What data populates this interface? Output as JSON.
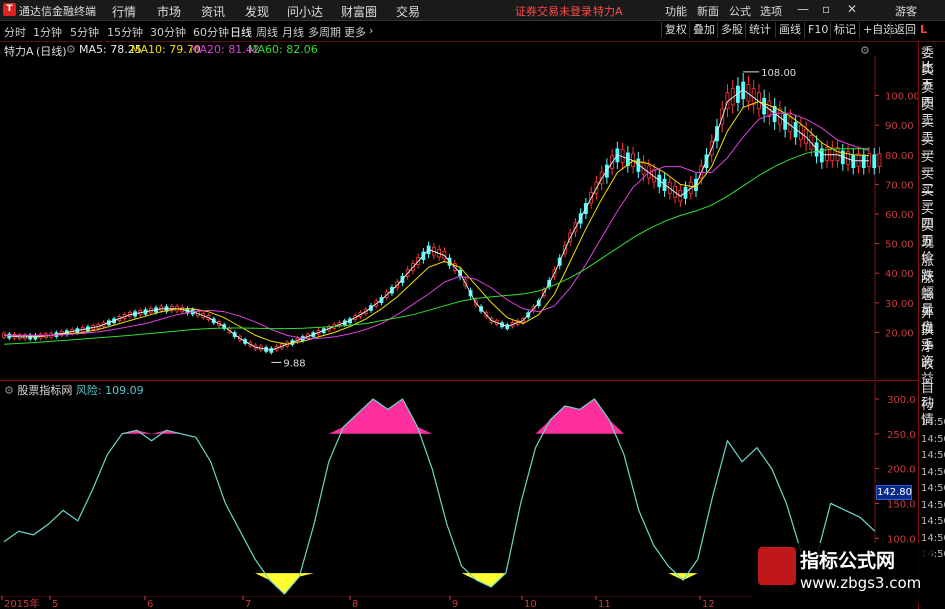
{
  "titlebar": {
    "app_title": "通达信金融终端",
    "menus": [
      "行情",
      "市场",
      "资讯",
      "发现",
      "问小达",
      "财富圈",
      "交易"
    ],
    "notice": "证券交易未登录",
    "stock_name": "特力A",
    "right_menus": [
      "功能",
      "新面",
      "公式",
      "选项"
    ],
    "guest": "游客"
  },
  "toolbar": {
    "periods": [
      "分时",
      "1分钟",
      "5分钟",
      "15分钟",
      "30分钟",
      "60分钟",
      "日线",
      "周线",
      "月线",
      "多周期",
      "更多"
    ],
    "active_period": "日线",
    "buttons": [
      "复权",
      "叠加",
      "多股",
      "统计",
      "画线",
      "F10",
      "标记",
      "+自选",
      "返回"
    ]
  },
  "infobar": {
    "stock_label": "特力A",
    "period_label": "(日线)",
    "ma5": "MA5: 78.25",
    "ma10": "MA10: 79.70",
    "ma20": "MA20: 81.42",
    "ma60": "MA60: 82.06",
    "colors": {
      "ma5": "#e8e8e8",
      "ma10": "#f0e000",
      "ma20": "#e040e0",
      "ma60": "#30e030"
    }
  },
  "indicator": {
    "label": "股票指标网",
    "risk_label": "风险:",
    "risk_value": "109.09",
    "current_badge": "142.80"
  },
  "main_chart_annotations": {
    "high_label": "108.00",
    "low_label": "9.88"
  },
  "sidebar": {
    "items": [
      "委比",
      "卖五",
      "卖四",
      "卖三",
      "卖二",
      "卖一",
      "买一",
      "买二",
      "买三",
      "买四",
      "买五",
      "现价",
      "涨跌",
      "涨幅",
      "总量",
      "外盘",
      "换手",
      "净资",
      "收益",
      "自动",
      "行情",
      "14:50",
      "14:50",
      "14:50",
      "14:50",
      "14:50",
      "14:50",
      "14:50",
      "14:50",
      "14:50"
    ]
  },
  "chart_data": [
    {
      "type": "candlestick",
      "title": "特力A (日线)",
      "y_ticks": [
        "100.00",
        "90.00",
        "80.00",
        "70.00",
        "60.00",
        "50.00",
        "40.00",
        "30.00",
        "20.00"
      ],
      "ylim": [
        8,
        112
      ],
      "series": [
        {
          "name": "MA5",
          "values": [
            19,
            18.5,
            18.5,
            19,
            20,
            21,
            22,
            24,
            26,
            27,
            28,
            28,
            27,
            25,
            22,
            18,
            15,
            14,
            16,
            18,
            20,
            22,
            24,
            27,
            31,
            36,
            42,
            48,
            46,
            40,
            30,
            24,
            22,
            24,
            30,
            40,
            52,
            62,
            72,
            80,
            78,
            74,
            70,
            66,
            70,
            82,
            98,
            102,
            98,
            94,
            90,
            86,
            80,
            80,
            78,
            78
          ]
        },
        {
          "name": "MA10",
          "values": [
            19,
            19,
            18.8,
            19,
            19.5,
            20,
            21,
            22.5,
            24,
            25.5,
            27,
            28,
            28,
            27,
            25,
            22,
            19,
            17,
            16,
            17,
            18.5,
            20,
            22,
            24.5,
            28,
            32,
            37,
            42,
            44,
            42,
            36,
            30,
            25,
            23,
            26,
            33,
            44,
            55,
            65,
            74,
            78,
            77,
            74,
            70,
            69,
            76,
            88,
            96,
            98,
            96,
            93,
            89,
            84,
            81,
            80,
            79.7
          ]
        },
        {
          "name": "MA20",
          "values": [
            19,
            19,
            19,
            19,
            19.3,
            19.7,
            20.2,
            21,
            22,
            23,
            24.5,
            26,
            27,
            27.5,
            27,
            25.5,
            23.5,
            21,
            19,
            18,
            18,
            18.5,
            19.5,
            21,
            23,
            26,
            29.5,
            33,
            37,
            39,
            38,
            35,
            31,
            28,
            27,
            29,
            35,
            43,
            52,
            61,
            69,
            74,
            76,
            76,
            74,
            74,
            79,
            86,
            92,
            94,
            94,
            92,
            89,
            85,
            83,
            81.4
          ]
        },
        {
          "name": "MA60",
          "values": [
            16,
            16.3,
            16.6,
            17,
            17.4,
            17.8,
            18.2,
            18.6,
            19,
            19.5,
            20,
            20.5,
            21,
            21.3,
            21.5,
            21.5,
            21.4,
            21.3,
            21.3,
            21.4,
            21.7,
            22,
            22.5,
            23,
            24,
            25,
            26,
            27.5,
            29,
            30.5,
            31.5,
            32,
            32.5,
            33,
            34,
            36,
            38.5,
            41.5,
            45,
            48.5,
            52,
            55,
            57.5,
            59.5,
            61,
            63,
            66,
            69.5,
            73,
            76,
            78.5,
            80.5,
            81.5,
            82,
            82,
            82.06
          ]
        }
      ],
      "high": 108.0,
      "low": 9.88
    },
    {
      "type": "area",
      "title": "股票指标网 风险: 109.09",
      "y_ticks": [
        "300.0",
        "250.0",
        "200.0",
        "150.0",
        "100.0"
      ],
      "ylim": [
        20,
        310
      ],
      "x_ticks": [
        "2015年",
        "5",
        "6",
        "7",
        "8",
        "9",
        "10",
        "11",
        "12"
      ],
      "thresholds": {
        "upper": 250,
        "lower": 50
      },
      "values": [
        95,
        110,
        105,
        120,
        140,
        125,
        170,
        220,
        250,
        255,
        240,
        255,
        250,
        245,
        210,
        150,
        110,
        70,
        40,
        20,
        45,
        120,
        210,
        260,
        280,
        300,
        285,
        300,
        260,
        200,
        120,
        60,
        40,
        30,
        50,
        150,
        230,
        270,
        290,
        285,
        300,
        270,
        220,
        140,
        90,
        60,
        40,
        70,
        160,
        240,
        210,
        230,
        200,
        150,
        80,
        70,
        150,
        140,
        130,
        110
      ]
    }
  ]
}
